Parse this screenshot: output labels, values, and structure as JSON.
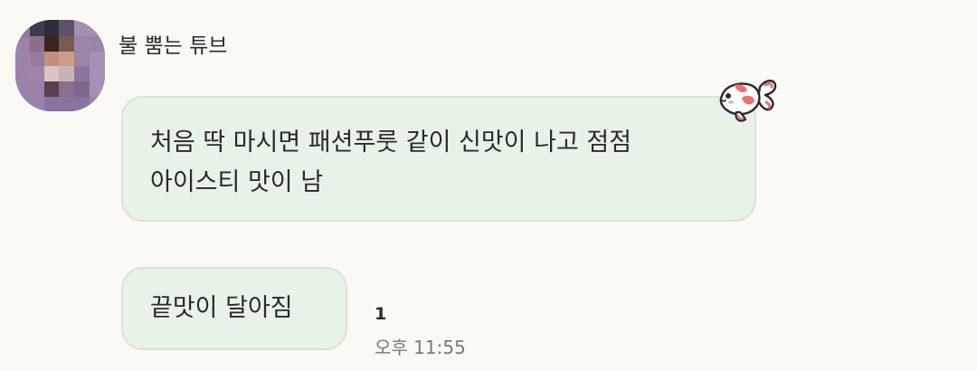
{
  "chat": {
    "sender": {
      "name": "불 뿜는 튜브"
    },
    "messages": [
      {
        "lines": [
          "처음 딱 마시면 패션푸룻 같이 신맛이 나고 점점",
          "아이스티 맛이 남"
        ]
      },
      {
        "text": "끝맛이 달아짐",
        "unread_count": "1",
        "time": "오후 11:55"
      }
    ]
  },
  "sticker": {
    "icon": "goldfish-icon"
  },
  "colors": {
    "background": "#fbf9f4",
    "bubble_fill": "#e8f3e8",
    "bubble_border": "#d6e6d6",
    "fish_accent": "#e9746e"
  }
}
